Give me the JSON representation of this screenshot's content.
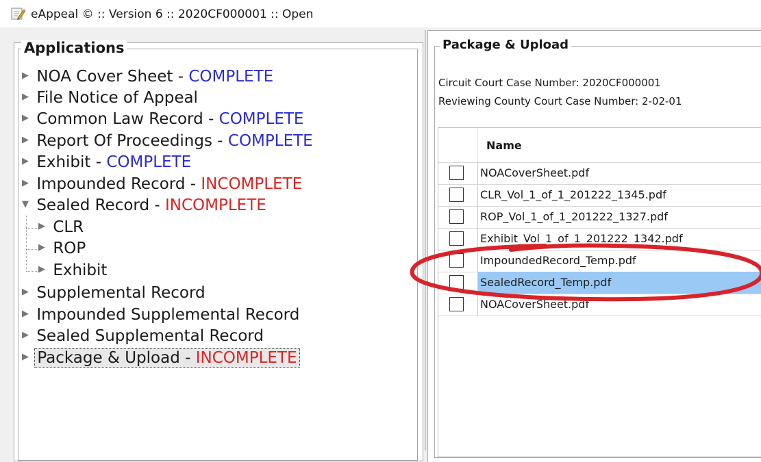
{
  "window": {
    "title": "eAppeal © :: Version 6 :: 2020CF000001 :: Open",
    "icon": "document-pen-icon"
  },
  "applications": {
    "legend": "Applications",
    "items": [
      {
        "label": "NOA Cover Sheet",
        "sep": " - ",
        "status": "COMPLETE",
        "status_kind": "complete"
      },
      {
        "label": "File Notice of Appeal",
        "sep": "",
        "status": "",
        "status_kind": "none"
      },
      {
        "label": "Common Law Record",
        "sep": " - ",
        "status": "COMPLETE",
        "status_kind": "complete"
      },
      {
        "label": "Report Of Proceedings",
        "sep": " - ",
        "status": "COMPLETE",
        "status_kind": "complete"
      },
      {
        "label": "Exhibit",
        "sep": " - ",
        "status": "COMPLETE",
        "status_kind": "complete"
      },
      {
        "label": "Impounded Record",
        "sep": " - ",
        "status": "INCOMPLETE",
        "status_kind": "incomplete"
      },
      {
        "label": "Sealed Record",
        "sep": " - ",
        "status": "INCOMPLETE",
        "status_kind": "incomplete",
        "expanded": true,
        "children": [
          {
            "label": "CLR"
          },
          {
            "label": "ROP"
          },
          {
            "label": "Exhibit"
          }
        ]
      },
      {
        "label": "Supplemental Record",
        "sep": "",
        "status": "",
        "status_kind": "none"
      },
      {
        "label": "Impounded Supplemental Record",
        "sep": "",
        "status": "",
        "status_kind": "none"
      },
      {
        "label": "Sealed Supplemental Record",
        "sep": "",
        "status": "",
        "status_kind": "none"
      },
      {
        "label": "Package & Upload",
        "sep": " - ",
        "status": "INCOMPLETE",
        "status_kind": "incomplete",
        "selected": true
      }
    ]
  },
  "package": {
    "legend": "Package & Upload",
    "circuit_case": "Circuit Court Case Number: 2020CF000001",
    "reviewing_case": "Reviewing County Court Case Number: 2-02-01",
    "table": {
      "header_name": "Name",
      "rows": [
        {
          "name": "NOACoverSheet.pdf",
          "selected": false
        },
        {
          "name": "CLR_Vol_1_of_1_201222_1345.pdf",
          "selected": false
        },
        {
          "name": "ROP_Vol_1_of_1_201222_1327.pdf",
          "selected": false
        },
        {
          "name": "Exhibit_Vol_1_of_1_201222_1342.pdf",
          "selected": false
        },
        {
          "name": "ImpoundedRecord_Temp.pdf",
          "selected": false
        },
        {
          "name": "SealedRecord_Temp.pdf",
          "selected": true
        },
        {
          "name": "NOACoverSheet.pdf",
          "selected": false
        }
      ]
    }
  },
  "colors": {
    "complete": "#2b2bd8",
    "incomplete": "#e02222",
    "selected_row": "#99c9f4",
    "annotation": "#d8232a"
  }
}
